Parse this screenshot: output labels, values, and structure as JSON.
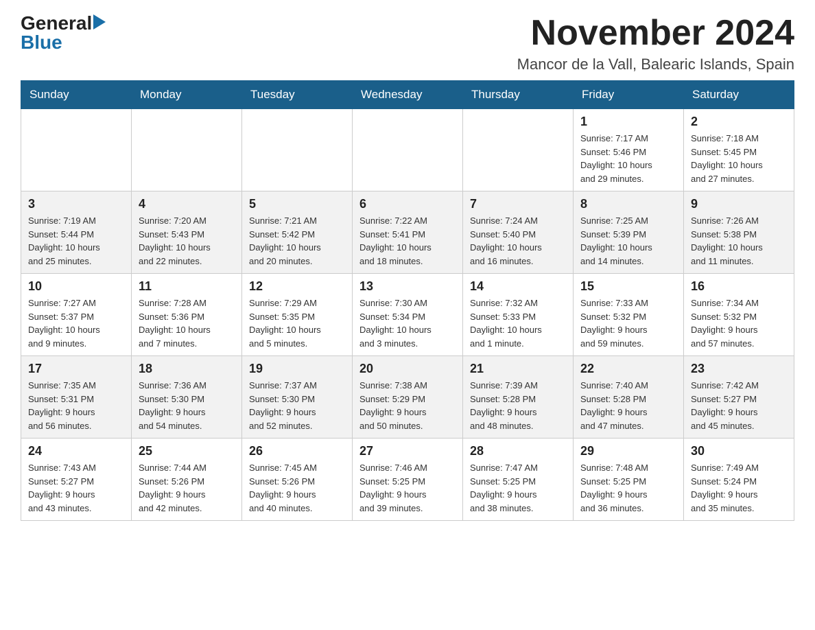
{
  "header": {
    "logo_general": "General",
    "logo_blue": "Blue",
    "month_title": "November 2024",
    "location": "Mancor de la Vall, Balearic Islands, Spain"
  },
  "weekdays": [
    "Sunday",
    "Monday",
    "Tuesday",
    "Wednesday",
    "Thursday",
    "Friday",
    "Saturday"
  ],
  "weeks": [
    {
      "days": [
        {
          "num": "",
          "info": ""
        },
        {
          "num": "",
          "info": ""
        },
        {
          "num": "",
          "info": ""
        },
        {
          "num": "",
          "info": ""
        },
        {
          "num": "",
          "info": ""
        },
        {
          "num": "1",
          "info": "Sunrise: 7:17 AM\nSunset: 5:46 PM\nDaylight: 10 hours\nand 29 minutes."
        },
        {
          "num": "2",
          "info": "Sunrise: 7:18 AM\nSunset: 5:45 PM\nDaylight: 10 hours\nand 27 minutes."
        }
      ]
    },
    {
      "days": [
        {
          "num": "3",
          "info": "Sunrise: 7:19 AM\nSunset: 5:44 PM\nDaylight: 10 hours\nand 25 minutes."
        },
        {
          "num": "4",
          "info": "Sunrise: 7:20 AM\nSunset: 5:43 PM\nDaylight: 10 hours\nand 22 minutes."
        },
        {
          "num": "5",
          "info": "Sunrise: 7:21 AM\nSunset: 5:42 PM\nDaylight: 10 hours\nand 20 minutes."
        },
        {
          "num": "6",
          "info": "Sunrise: 7:22 AM\nSunset: 5:41 PM\nDaylight: 10 hours\nand 18 minutes."
        },
        {
          "num": "7",
          "info": "Sunrise: 7:24 AM\nSunset: 5:40 PM\nDaylight: 10 hours\nand 16 minutes."
        },
        {
          "num": "8",
          "info": "Sunrise: 7:25 AM\nSunset: 5:39 PM\nDaylight: 10 hours\nand 14 minutes."
        },
        {
          "num": "9",
          "info": "Sunrise: 7:26 AM\nSunset: 5:38 PM\nDaylight: 10 hours\nand 11 minutes."
        }
      ]
    },
    {
      "days": [
        {
          "num": "10",
          "info": "Sunrise: 7:27 AM\nSunset: 5:37 PM\nDaylight: 10 hours\nand 9 minutes."
        },
        {
          "num": "11",
          "info": "Sunrise: 7:28 AM\nSunset: 5:36 PM\nDaylight: 10 hours\nand 7 minutes."
        },
        {
          "num": "12",
          "info": "Sunrise: 7:29 AM\nSunset: 5:35 PM\nDaylight: 10 hours\nand 5 minutes."
        },
        {
          "num": "13",
          "info": "Sunrise: 7:30 AM\nSunset: 5:34 PM\nDaylight: 10 hours\nand 3 minutes."
        },
        {
          "num": "14",
          "info": "Sunrise: 7:32 AM\nSunset: 5:33 PM\nDaylight: 10 hours\nand 1 minute."
        },
        {
          "num": "15",
          "info": "Sunrise: 7:33 AM\nSunset: 5:32 PM\nDaylight: 9 hours\nand 59 minutes."
        },
        {
          "num": "16",
          "info": "Sunrise: 7:34 AM\nSunset: 5:32 PM\nDaylight: 9 hours\nand 57 minutes."
        }
      ]
    },
    {
      "days": [
        {
          "num": "17",
          "info": "Sunrise: 7:35 AM\nSunset: 5:31 PM\nDaylight: 9 hours\nand 56 minutes."
        },
        {
          "num": "18",
          "info": "Sunrise: 7:36 AM\nSunset: 5:30 PM\nDaylight: 9 hours\nand 54 minutes."
        },
        {
          "num": "19",
          "info": "Sunrise: 7:37 AM\nSunset: 5:30 PM\nDaylight: 9 hours\nand 52 minutes."
        },
        {
          "num": "20",
          "info": "Sunrise: 7:38 AM\nSunset: 5:29 PM\nDaylight: 9 hours\nand 50 minutes."
        },
        {
          "num": "21",
          "info": "Sunrise: 7:39 AM\nSunset: 5:28 PM\nDaylight: 9 hours\nand 48 minutes."
        },
        {
          "num": "22",
          "info": "Sunrise: 7:40 AM\nSunset: 5:28 PM\nDaylight: 9 hours\nand 47 minutes."
        },
        {
          "num": "23",
          "info": "Sunrise: 7:42 AM\nSunset: 5:27 PM\nDaylight: 9 hours\nand 45 minutes."
        }
      ]
    },
    {
      "days": [
        {
          "num": "24",
          "info": "Sunrise: 7:43 AM\nSunset: 5:27 PM\nDaylight: 9 hours\nand 43 minutes."
        },
        {
          "num": "25",
          "info": "Sunrise: 7:44 AM\nSunset: 5:26 PM\nDaylight: 9 hours\nand 42 minutes."
        },
        {
          "num": "26",
          "info": "Sunrise: 7:45 AM\nSunset: 5:26 PM\nDaylight: 9 hours\nand 40 minutes."
        },
        {
          "num": "27",
          "info": "Sunrise: 7:46 AM\nSunset: 5:25 PM\nDaylight: 9 hours\nand 39 minutes."
        },
        {
          "num": "28",
          "info": "Sunrise: 7:47 AM\nSunset: 5:25 PM\nDaylight: 9 hours\nand 38 minutes."
        },
        {
          "num": "29",
          "info": "Sunrise: 7:48 AM\nSunset: 5:25 PM\nDaylight: 9 hours\nand 36 minutes."
        },
        {
          "num": "30",
          "info": "Sunrise: 7:49 AM\nSunset: 5:24 PM\nDaylight: 9 hours\nand 35 minutes."
        }
      ]
    }
  ]
}
